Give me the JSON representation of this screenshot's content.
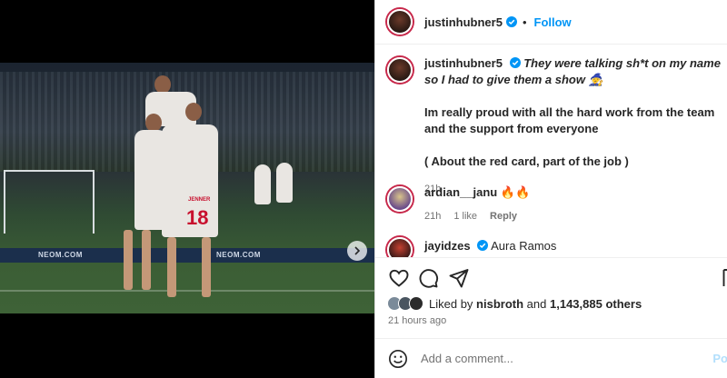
{
  "post": {
    "author": "justinhubner5",
    "follow_label": "Follow",
    "dot": "•",
    "board_left": "NEOM.COM",
    "board_right": "NEOM.COM",
    "shirt_name": "JENNER",
    "shirt_number": "18"
  },
  "comments": [
    {
      "user": "justinhubner5",
      "caption": "They were talking sh*t on my name so I had to give them a show 🧙",
      "para1": "Im really proud with all the hard work from the team and the support from everyone",
      "para2": "( About the red card, part of the job )",
      "time": "21h"
    },
    {
      "user": "ardian__janu",
      "text": "🔥🔥",
      "time": "21h",
      "likes": "1 like",
      "reply": "Reply"
    },
    {
      "user": "jayidzes",
      "text": "Aura Ramos"
    }
  ],
  "likes": {
    "prefix": "Liked by",
    "user": "nisbroth",
    "joiner": "and",
    "count": "1,143,885 others"
  },
  "timestamp": "21 hours ago",
  "composer": {
    "placeholder": "Add a comment...",
    "post_label": "Po"
  },
  "colors": {
    "accent": "#0095f6",
    "verified": "#0095f6",
    "ring": "#c7284a"
  }
}
